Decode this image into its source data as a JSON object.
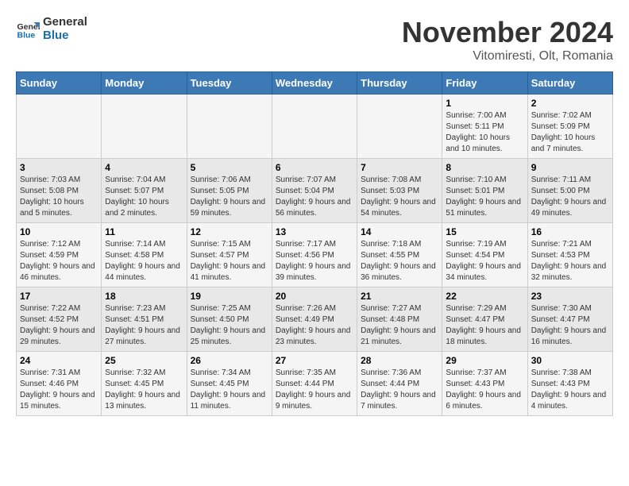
{
  "logo": {
    "line1": "General",
    "line2": "Blue"
  },
  "title": "November 2024",
  "subtitle": "Vitomiresti, Olt, Romania",
  "weekdays": [
    "Sunday",
    "Monday",
    "Tuesday",
    "Wednesday",
    "Thursday",
    "Friday",
    "Saturday"
  ],
  "weeks": [
    [
      {
        "day": "",
        "info": ""
      },
      {
        "day": "",
        "info": ""
      },
      {
        "day": "",
        "info": ""
      },
      {
        "day": "",
        "info": ""
      },
      {
        "day": "",
        "info": ""
      },
      {
        "day": "1",
        "info": "Sunrise: 7:00 AM\nSunset: 5:11 PM\nDaylight: 10 hours and 10 minutes."
      },
      {
        "day": "2",
        "info": "Sunrise: 7:02 AM\nSunset: 5:09 PM\nDaylight: 10 hours and 7 minutes."
      }
    ],
    [
      {
        "day": "3",
        "info": "Sunrise: 7:03 AM\nSunset: 5:08 PM\nDaylight: 10 hours and 5 minutes."
      },
      {
        "day": "4",
        "info": "Sunrise: 7:04 AM\nSunset: 5:07 PM\nDaylight: 10 hours and 2 minutes."
      },
      {
        "day": "5",
        "info": "Sunrise: 7:06 AM\nSunset: 5:05 PM\nDaylight: 9 hours and 59 minutes."
      },
      {
        "day": "6",
        "info": "Sunrise: 7:07 AM\nSunset: 5:04 PM\nDaylight: 9 hours and 56 minutes."
      },
      {
        "day": "7",
        "info": "Sunrise: 7:08 AM\nSunset: 5:03 PM\nDaylight: 9 hours and 54 minutes."
      },
      {
        "day": "8",
        "info": "Sunrise: 7:10 AM\nSunset: 5:01 PM\nDaylight: 9 hours and 51 minutes."
      },
      {
        "day": "9",
        "info": "Sunrise: 7:11 AM\nSunset: 5:00 PM\nDaylight: 9 hours and 49 minutes."
      }
    ],
    [
      {
        "day": "10",
        "info": "Sunrise: 7:12 AM\nSunset: 4:59 PM\nDaylight: 9 hours and 46 minutes."
      },
      {
        "day": "11",
        "info": "Sunrise: 7:14 AM\nSunset: 4:58 PM\nDaylight: 9 hours and 44 minutes."
      },
      {
        "day": "12",
        "info": "Sunrise: 7:15 AM\nSunset: 4:57 PM\nDaylight: 9 hours and 41 minutes."
      },
      {
        "day": "13",
        "info": "Sunrise: 7:17 AM\nSunset: 4:56 PM\nDaylight: 9 hours and 39 minutes."
      },
      {
        "day": "14",
        "info": "Sunrise: 7:18 AM\nSunset: 4:55 PM\nDaylight: 9 hours and 36 minutes."
      },
      {
        "day": "15",
        "info": "Sunrise: 7:19 AM\nSunset: 4:54 PM\nDaylight: 9 hours and 34 minutes."
      },
      {
        "day": "16",
        "info": "Sunrise: 7:21 AM\nSunset: 4:53 PM\nDaylight: 9 hours and 32 minutes."
      }
    ],
    [
      {
        "day": "17",
        "info": "Sunrise: 7:22 AM\nSunset: 4:52 PM\nDaylight: 9 hours and 29 minutes."
      },
      {
        "day": "18",
        "info": "Sunrise: 7:23 AM\nSunset: 4:51 PM\nDaylight: 9 hours and 27 minutes."
      },
      {
        "day": "19",
        "info": "Sunrise: 7:25 AM\nSunset: 4:50 PM\nDaylight: 9 hours and 25 minutes."
      },
      {
        "day": "20",
        "info": "Sunrise: 7:26 AM\nSunset: 4:49 PM\nDaylight: 9 hours and 23 minutes."
      },
      {
        "day": "21",
        "info": "Sunrise: 7:27 AM\nSunset: 4:48 PM\nDaylight: 9 hours and 21 minutes."
      },
      {
        "day": "22",
        "info": "Sunrise: 7:29 AM\nSunset: 4:47 PM\nDaylight: 9 hours and 18 minutes."
      },
      {
        "day": "23",
        "info": "Sunrise: 7:30 AM\nSunset: 4:47 PM\nDaylight: 9 hours and 16 minutes."
      }
    ],
    [
      {
        "day": "24",
        "info": "Sunrise: 7:31 AM\nSunset: 4:46 PM\nDaylight: 9 hours and 15 minutes."
      },
      {
        "day": "25",
        "info": "Sunrise: 7:32 AM\nSunset: 4:45 PM\nDaylight: 9 hours and 13 minutes."
      },
      {
        "day": "26",
        "info": "Sunrise: 7:34 AM\nSunset: 4:45 PM\nDaylight: 9 hours and 11 minutes."
      },
      {
        "day": "27",
        "info": "Sunrise: 7:35 AM\nSunset: 4:44 PM\nDaylight: 9 hours and 9 minutes."
      },
      {
        "day": "28",
        "info": "Sunrise: 7:36 AM\nSunset: 4:44 PM\nDaylight: 9 hours and 7 minutes."
      },
      {
        "day": "29",
        "info": "Sunrise: 7:37 AM\nSunset: 4:43 PM\nDaylight: 9 hours and 6 minutes."
      },
      {
        "day": "30",
        "info": "Sunrise: 7:38 AM\nSunset: 4:43 PM\nDaylight: 9 hours and 4 minutes."
      }
    ]
  ]
}
